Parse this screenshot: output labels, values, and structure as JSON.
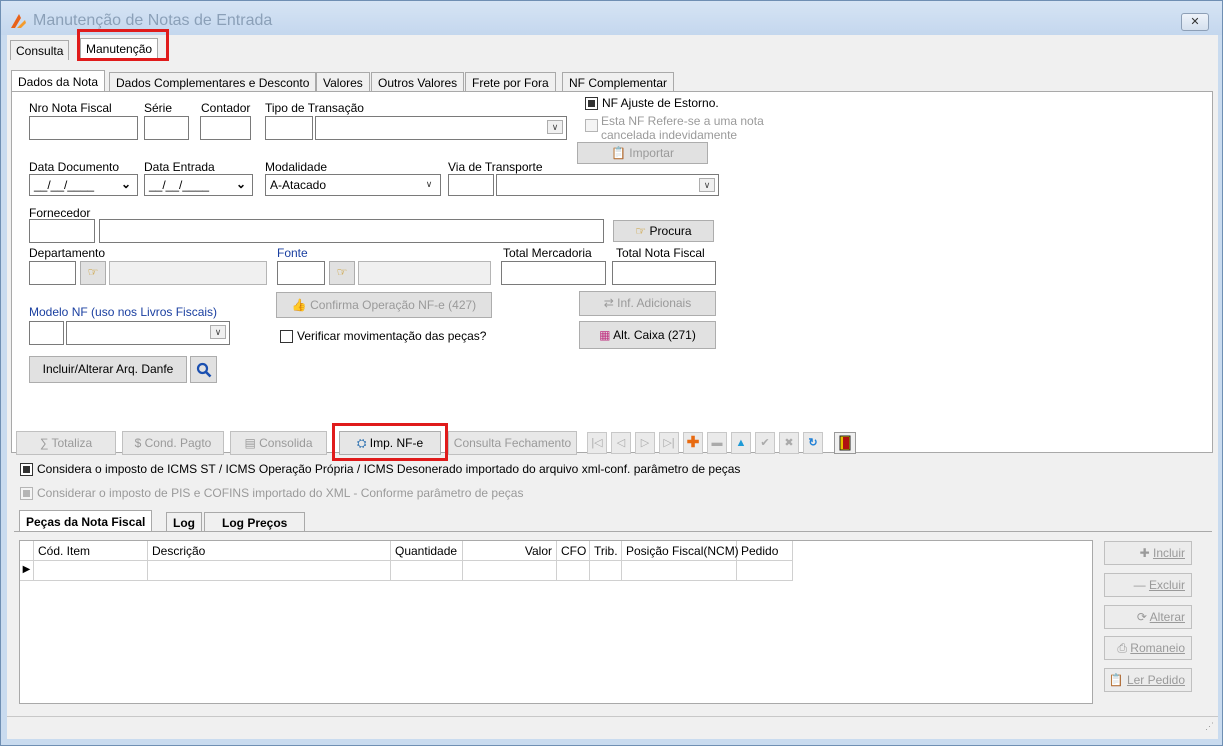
{
  "window": {
    "title": "Manutenção de Notas de Entrada",
    "close_label": "✕"
  },
  "main_tabs": [
    "Consulta",
    "Manutenção"
  ],
  "sub_tabs": [
    "Dados da Nota",
    "Dados Complementares e Desconto",
    "Valores",
    "Outros Valores",
    "Frete por Fora",
    "NF Complementar"
  ],
  "fields": {
    "nro_nota": "Nro Nota Fiscal",
    "serie": "Série",
    "contador": "Contador",
    "tipo_transacao": "Tipo de Transação",
    "data_documento": "Data Documento",
    "data_documento_value": "__/__/____",
    "data_entrada": "Data Entrada",
    "data_entrada_value": "__/__/____",
    "modalidade": "Modalidade",
    "modalidade_value": "A-Atacado",
    "via_transporte": "Via de Transporte",
    "fornecedor": "Fornecedor",
    "departamento": "Departamento",
    "fonte": "Fonte",
    "total_mercadoria": "Total Mercadoria",
    "total_nota": "Total Nota Fiscal",
    "modelo_nf": "Modelo NF (uso nos Livros Fiscais)"
  },
  "checks": {
    "nf_ajuste": "NF Ajuste  de Estorno.",
    "nf_refere_1": "Esta NF Refere-se a uma nota",
    "nf_refere_2": "cancelada indevidamente",
    "verificar": "Verificar movimentação das peças?",
    "considera_icms": "Considera o imposto de ICMS ST / ICMS Operação Própria / ICMS Desonerado importado do arquivo xml-conf. parâmetro de peças",
    "considerar_pis": "Considerar o imposto de PIS e COFINS importado do XML - Conforme parâmetro de peças"
  },
  "buttons": {
    "importar": "Importar",
    "procura": "Procura",
    "confirma": "Confirma Operação NF-e (427)",
    "inf_adicionais": "Inf. Adicionais",
    "alt_caixa": "Alt. Caixa (271)",
    "incluir_danfe": "Incluir/Alterar Arq. Danfe"
  },
  "toolbar": {
    "totaliza": "Totaliza",
    "cond_pagto": "Cond. Pagto",
    "consolida": "Consolida",
    "imp_nfe": "Imp. NF-e",
    "consulta_fechamento": "Consulta Fechamento"
  },
  "item_tabs": [
    "Peças da Nota Fiscal",
    "Log",
    "Log Preços"
  ],
  "grid": {
    "columns": [
      "Cód. Item",
      "Descrição",
      "Quantidade",
      "Valor",
      "CFO",
      "Trib.",
      "Posição Fiscal(NCM)",
      "Pedido"
    ]
  },
  "side_buttons": [
    "Incluir",
    "Excluir",
    "Alterar",
    "Romaneio",
    "Ler Pedido"
  ],
  "colors": {
    "highlight": "#e01b1b",
    "window_frame": "#c9dbef",
    "label_blue": "#1a3fa0"
  }
}
